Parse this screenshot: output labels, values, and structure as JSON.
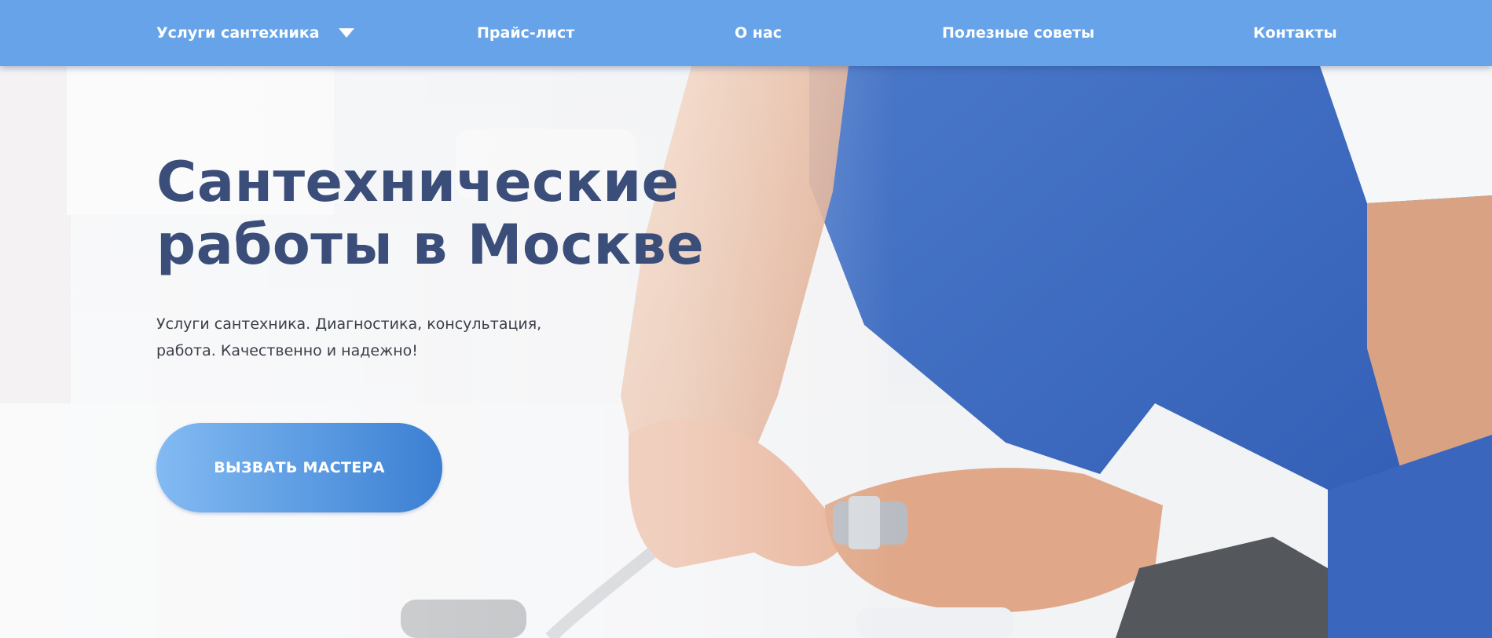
{
  "nav": {
    "items": [
      {
        "label": "Услуги сантехника",
        "has_dropdown": true
      },
      {
        "label": "Прайс-лист"
      },
      {
        "label": "О нас"
      },
      {
        "label": "Полезные советы"
      },
      {
        "label": "Контакты"
      }
    ],
    "background_color": "#66a3e8"
  },
  "hero": {
    "title_lines": [
      "Сантехнические",
      "работы в Москве"
    ],
    "subtitle_lines": [
      "Услуги сантехника. Диагностика, консультация,",
      "работа. Качественно и надежно!"
    ],
    "cta_label": "ВЫЗВАТЬ МАСТЕРА",
    "title_color": "#3b4e7a",
    "cta_gradient": [
      "#83baf2",
      "#3c7fd2"
    ]
  },
  "icons": {
    "dropdown": "chevron-down-icon"
  }
}
